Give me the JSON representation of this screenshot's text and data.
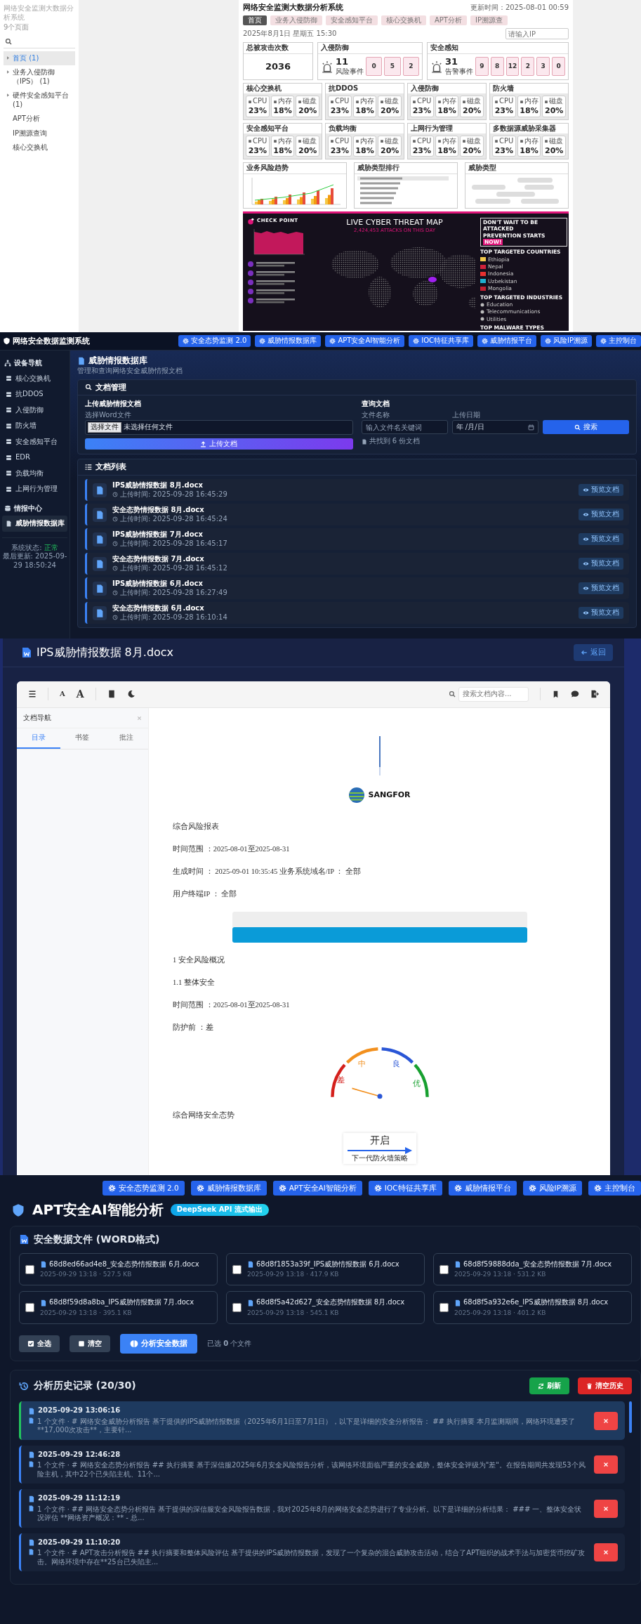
{
  "dashboard_page": {
    "sidebar": {
      "title": "网络安全监测大数据分析系统",
      "subtitle": "9个页面",
      "items": [
        {
          "label": "首页 (1)",
          "selected": true,
          "expandable": true
        },
        {
          "label": "业务入侵防御（IPS） (1)",
          "selected": false,
          "expandable": true
        },
        {
          "label": "硬件安全感知平台 (1)",
          "selected": false,
          "expandable": true
        },
        {
          "label": "APT分析",
          "selected": false,
          "expandable": false
        },
        {
          "label": "IP溯源查询",
          "selected": false,
          "expandable": false
        },
        {
          "label": "核心交换机",
          "selected": false,
          "expandable": false
        }
      ]
    },
    "header": {
      "title": "网络安全监测大数据分析系统",
      "update_time": "更新时间：2025-08-01 00:59",
      "nav": [
        {
          "label": "首页",
          "selected": true
        },
        {
          "label": "业务入侵防御",
          "selected": false
        },
        {
          "label": "安全感知平台",
          "selected": false
        },
        {
          "label": "核心交换机",
          "selected": false
        },
        {
          "label": "APT分析",
          "selected": false
        },
        {
          "label": "IP溯源查",
          "selected": false
        }
      ]
    },
    "date": "2025年8月1日 星期五 15:30",
    "search": {
      "placeholder": "请输入IP"
    },
    "total_attacks": {
      "title": "总被攻击次数",
      "value": "2036"
    },
    "ips": {
      "title": "入侵防御",
      "value": "11",
      "label": "风险事件",
      "stats": [
        "0",
        "5",
        "2"
      ]
    },
    "sensing": {
      "title": "安全感知",
      "value": "31",
      "label": "告警事件",
      "stats": [
        "9",
        "8",
        "12",
        "2",
        "3",
        "0"
      ]
    },
    "devices": [
      {
        "name": "核心交换机",
        "metrics": [
          {
            "label": "CPU",
            "value": "23%"
          },
          {
            "label": "内存",
            "value": "18%"
          },
          {
            "label": "磁盘",
            "value": "20%"
          }
        ]
      },
      {
        "name": "抗DDOS",
        "metrics": [
          {
            "label": "CPU",
            "value": "23%"
          },
          {
            "label": "内存",
            "value": "18%"
          },
          {
            "label": "磁盘",
            "value": "20%"
          }
        ]
      },
      {
        "name": "入侵防御",
        "metrics": [
          {
            "label": "CPU",
            "value": "23%"
          },
          {
            "label": "内存",
            "value": "18%"
          },
          {
            "label": "磁盘",
            "value": "20%"
          }
        ]
      },
      {
        "name": "防火墙",
        "metrics": [
          {
            "label": "CPU",
            "value": "23%"
          },
          {
            "label": "内存",
            "value": "18%"
          },
          {
            "label": "磁盘",
            "value": "20%"
          }
        ]
      },
      {
        "name": "安全感知平台",
        "metrics": [
          {
            "label": "CPU",
            "value": "23%"
          },
          {
            "label": "内存",
            "value": "18%"
          },
          {
            "label": "磁盘",
            "value": "20%"
          }
        ]
      },
      {
        "name": "负载均衡",
        "metrics": [
          {
            "label": "CPU",
            "value": "23%"
          },
          {
            "label": "内存",
            "value": "18%"
          },
          {
            "label": "磁盘",
            "value": "20%"
          }
        ]
      },
      {
        "name": "上网行为管理",
        "metrics": [
          {
            "label": "CPU",
            "value": "23%"
          },
          {
            "label": "内存",
            "value": "18%"
          },
          {
            "label": "磁盘",
            "value": "20%"
          }
        ]
      },
      {
        "name": "多数据源威胁采集器",
        "metrics": [
          {
            "label": "CPU",
            "value": "23%"
          },
          {
            "label": "内存",
            "value": "18%"
          },
          {
            "label": "磁盘",
            "value": "20%"
          }
        ]
      }
    ],
    "panels": [
      {
        "kind": "chart",
        "title": "业务风险趋势"
      },
      {
        "kind": "list",
        "title": "威胁类型排行"
      },
      {
        "kind": "tags",
        "title": "威胁类型"
      }
    ],
    "threat_map": {
      "brand": "CHECK POINT",
      "title": "LIVE CYBER THREAT MAP",
      "count": "2,424,453 ATTACKS ON THIS DAY",
      "cta": "DON'T WAIT TO BE ATTACKED",
      "cta2": "PREVENTION STARTS",
      "cta_highlight": "NOW!",
      "countries_title": "TOP TARGETED COUNTRIES",
      "countries": [
        {
          "name": "Ethiopia",
          "color": "#f2c94c"
        },
        {
          "name": "Nepal",
          "color": "#d0213a"
        },
        {
          "name": "Indonesia",
          "color": "#e53030"
        },
        {
          "name": "Uzbekistan",
          "color": "#1eb0d0"
        },
        {
          "name": "Mongolia",
          "color": "#c02030"
        }
      ],
      "industries_title": "TOP TARGETED INDUSTRIES",
      "industries": [
        "Education",
        "Telecommunications",
        "Utilities"
      ],
      "malware_title": "TOP MALWARE TYPES"
    }
  },
  "intel_db_page": {
    "brand": "网络安全数据监测系统",
    "nav": [
      "安全态势监测 2.0",
      "威胁情报数据库",
      "APT安全AI智能分析",
      "IOC特征共享库",
      "威胁情报平台",
      "风险IP溯源",
      "主控制台"
    ],
    "device_nav": {
      "title": "设备导航",
      "items": [
        {
          "label": "核心交换机",
          "selected": false
        },
        {
          "label": "抗DDOS",
          "selected": false
        },
        {
          "label": "入侵防御",
          "selected": false
        },
        {
          "label": "防火墙",
          "selected": false
        },
        {
          "label": "安全感知平台",
          "selected": false
        },
        {
          "label": "EDR",
          "selected": false
        },
        {
          "label": "负载均衡",
          "selected": false
        },
        {
          "label": "上网行为管理",
          "selected": false
        }
      ]
    },
    "intel_center": {
      "title": "情报中心",
      "items": [
        {
          "label": "威胁情报数据库",
          "selected": true
        }
      ]
    },
    "status": {
      "label": "系统状态:",
      "value": "正常",
      "updated": "最后更新: 2025-09-29 18:50:24"
    },
    "page_title": "威胁情报数据库",
    "page_subtitle": "管理和查询网络安全威胁情报文档",
    "manage": {
      "title": "文档管理",
      "upload": {
        "title": "上传威胁情报文档",
        "label": "选择Word文件",
        "choose_button": "选择文件",
        "no_file": "未选择任何文件",
        "button": "上传文档"
      },
      "query": {
        "title": "查询文档",
        "name_label": "文件名称",
        "name_placeholder": "输入文件名关键词",
        "date_label": "上传日期",
        "date_placeholder": "年 /月/日",
        "button": "搜索",
        "result": "共找到 6 份文档"
      }
    },
    "list": {
      "title": "文档列表",
      "docs": [
        {
          "name": "IPS威胁情报数据 8月.docx",
          "time": "上传时间: 2025-09-28 16:45:29",
          "action": "预览文档"
        },
        {
          "name": "安全态势情报数据 8月.docx",
          "time": "上传时间: 2025-09-28 16:45:24",
          "action": "预览文档"
        },
        {
          "name": "IPS威胁情报数据 7月.docx",
          "time": "上传时间: 2025-09-28 16:45:17",
          "action": "预览文档"
        },
        {
          "name": "安全态势情报数据 7月.docx",
          "time": "上传时间: 2025-09-28 16:45:12",
          "action": "预览文档"
        },
        {
          "name": "IPS威胁情报数据 6月.docx",
          "time": "上传时间: 2025-09-28 16:27:49",
          "action": "预览文档"
        },
        {
          "name": "安全态势情报数据 6月.docx",
          "time": "上传时间: 2025-09-28 16:10:14",
          "action": "预览文档"
        }
      ]
    }
  },
  "viewer_page": {
    "title": "IPS威胁情报数据 8月.docx",
    "back": "返回",
    "toolbar": {
      "font_small": "A",
      "font_large": "A",
      "search_placeholder": "搜索文档内容..."
    },
    "nav": {
      "title": "文档导航",
      "tabs": [
        {
          "label": "目录",
          "selected": true
        },
        {
          "label": "书签",
          "selected": false
        },
        {
          "label": "批注",
          "selected": false
        }
      ]
    },
    "blocks": [
      {
        "kind": "line"
      },
      {
        "kind": "logo",
        "text": "SANGFOR"
      },
      {
        "kind": "para",
        "text": "综合风险报表"
      },
      {
        "kind": "para",
        "text": "时间范围 ：2025-08-01至2025-08-31"
      },
      {
        "kind": "para",
        "text": "生成时间 ： 2025-09-01 10:35:45 业务系统域名/IP ： 全部"
      },
      {
        "kind": "para",
        "text": "用户终端IP ： 全部"
      },
      {
        "kind": "banner"
      },
      {
        "kind": "para",
        "text": "1 安全风险概况"
      },
      {
        "kind": "para",
        "text": "1.1 整体安全"
      },
      {
        "kind": "para",
        "text": "时间范围 ：2025-08-01至2025-08-31"
      },
      {
        "kind": "para",
        "text": "防护前 ：差"
      },
      {
        "kind": "gauge",
        "labels": [
          "差",
          "中",
          "良",
          "优"
        ]
      },
      {
        "kind": "para",
        "text": "综合网络安全态势"
      },
      {
        "kind": "switch",
        "text": "开启",
        "caption": "下一代防火墙策略"
      }
    ]
  },
  "apt_page": {
    "nav": [
      "安全态势监测 2.0",
      "威胁情报数据库",
      "APT安全AI智能分析",
      "IOC特征共享库",
      "威胁情报平台",
      "风险IP溯源",
      "主控制台"
    ],
    "title": "APT安全AI智能分析",
    "badge": "DeepSeek API 流式输出",
    "files": {
      "title": "安全数据文件 (WORD格式)",
      "items": [
        {
          "name": "68d8ed66ad4e8_安全态势情报数据 6月.docx",
          "meta": "2025-09-29 13:18 · 527.5 KB",
          "checked": false
        },
        {
          "name": "68d8f1853a39f_IPS威胁情报数据 6月.docx",
          "meta": "2025-09-29 13:18 · 417.9 KB",
          "checked": false
        },
        {
          "name": "68d8f59888dda_安全态势情报数据 7月.docx",
          "meta": "2025-09-29 13:18 · 531.2 KB",
          "checked": false
        },
        {
          "name": "68d8f59d8a8ba_IPS威胁情报数据 7月.docx",
          "meta": "2025-09-29 13:18 · 395.1 KB",
          "checked": false
        },
        {
          "name": "68d8f5a42d627_安全态势情报数据 8月.docx",
          "meta": "2025-09-29 13:18 · 545.1 KB",
          "checked": false
        },
        {
          "name": "68d8f5a932e6e_IPS威胁情报数据 8月.docx",
          "meta": "2025-09-29 13:18 · 401.2 KB",
          "checked": false
        }
      ],
      "select_all": "全选",
      "clear": "清空",
      "analyze": "分析安全数据",
      "selected_count": "已选 **0** 个文件"
    },
    "history": {
      "title": "分析历史记录 (20/30)",
      "refresh": "刷新",
      "clear": "清空历史",
      "items": [
        {
          "time": "2025-09-29 13:06:16",
          "summary": "1 个文件 · # 网络安全威胁分析报告 基于提供的IPS威胁情报数据（2025年6月1日至7月1日），以下是详细的安全分析报告： ## 执行摘要 本月监测期间，网络环境遭受了**17,000次攻击**，主要针...",
          "selected": true
        },
        {
          "time": "2025-09-29 12:46:28",
          "summary": "1 个文件 · # 网络安全态势分析报告 ## 执行摘要 基于深信服2025年6月安全风险报告分析，该网络环境面临严重的安全威胁，整体安全评级为\"差\"。在报告期间共发现53个风险主机，其中22个已失陷主机、11个...",
          "selected": false
        },
        {
          "time": "2025-09-29 11:12:19",
          "summary": "1 个文件 · ## 网络安全态势分析报告 基于提供的深信服安全风险报告数据，我对2025年8月的网络安全态势进行了专业分析。以下是详细的分析结果： ### 一、整体安全状况评估 **网络资产概况：** - 总...",
          "selected": false
        },
        {
          "time": "2025-09-29 11:10:20",
          "summary": "1 个文件 · # APT攻击分析报告 ## 执行摘要和整体风险评估 基于提供的IPS威胁情报数据，发现了一个复杂的混合威胁攻击活动，结合了APT组织的战术手法与加密货币挖矿攻击。网络环境中存在**25台已失陷主...",
          "selected": false
        }
      ]
    }
  }
}
